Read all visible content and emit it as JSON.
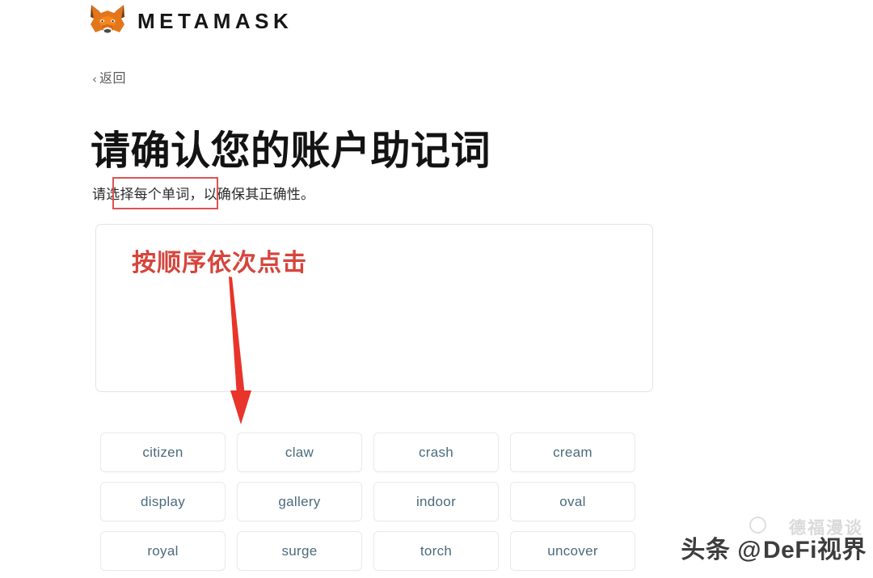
{
  "brand": {
    "logo_icon": "metamask-fox-icon",
    "name": "METAMASK"
  },
  "nav": {
    "back_chevron": "‹",
    "back_label": "返回"
  },
  "page": {
    "title": "请确认您的账户助记词",
    "subtitle": "请选择每个单词，以确保其正确性。"
  },
  "dropzone": {
    "selected_words": []
  },
  "annotations": {
    "instruction_text": "按顺序依次点击",
    "instruction_color": "#d6453c",
    "highlight_box_color": "#e05252",
    "arrow_color": "#e8342a"
  },
  "word_bank": {
    "words": [
      "citizen",
      "claw",
      "crash",
      "cream",
      "display",
      "gallery",
      "indoor",
      "oval",
      "royal",
      "surge",
      "torch",
      "uncover"
    ]
  },
  "watermark": {
    "faded_text": "德福漫谈",
    "handle_prefix": "头条 @",
    "handle_text": "DeFi视界"
  }
}
